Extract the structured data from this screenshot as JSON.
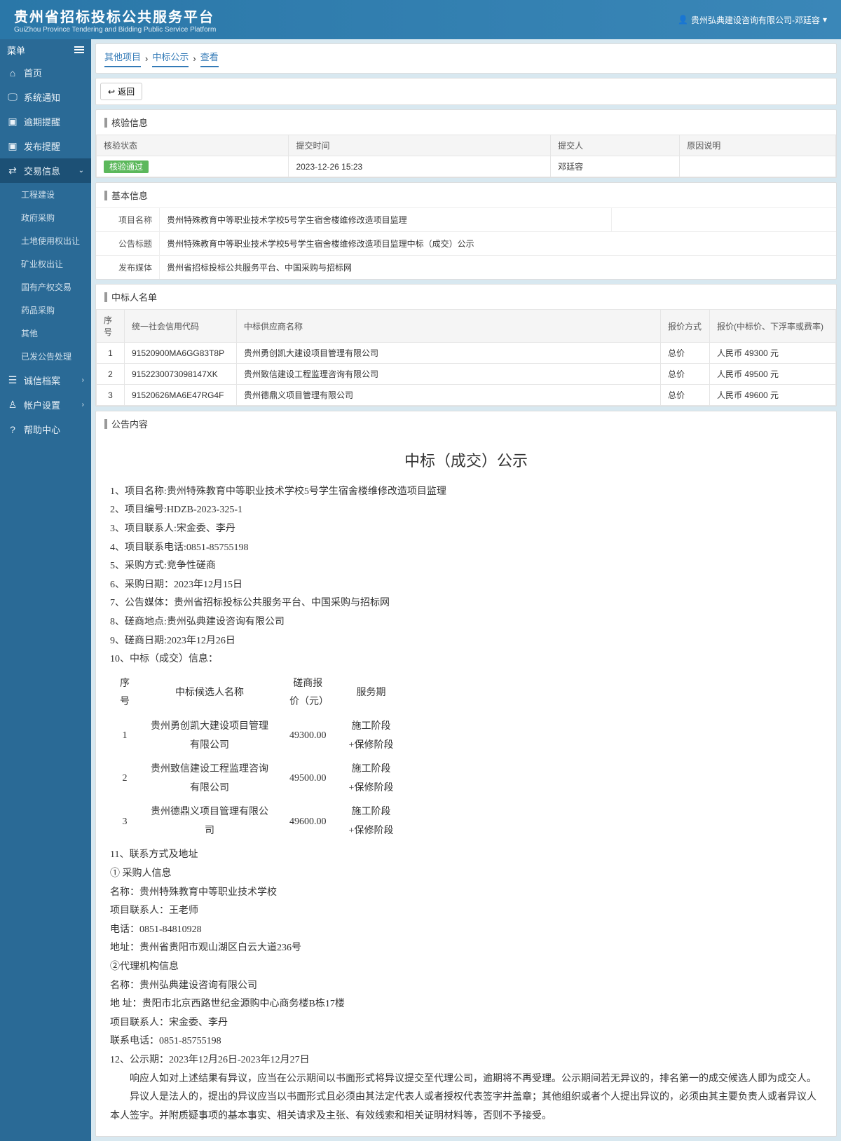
{
  "header": {
    "title": "贵州省招标投标公共服务平台",
    "subtitle": "GuiZhou Province Tendering and Bidding Public Service Platform",
    "user": "贵州弘典建设咨询有限公司-邓廷容"
  },
  "sidebar": {
    "menuLabel": "菜单",
    "items": [
      {
        "icon": "home",
        "label": "首页"
      },
      {
        "icon": "monitor",
        "label": "系统通知"
      },
      {
        "icon": "clock",
        "label": "逾期提醒"
      },
      {
        "icon": "bell",
        "label": "发布提醒"
      },
      {
        "icon": "exchange",
        "label": "交易信息",
        "active": true,
        "expanded": true
      },
      {
        "icon": "file",
        "label": "诚信档案",
        "chev": true
      },
      {
        "icon": "user",
        "label": "帐户设置",
        "chev": true
      },
      {
        "icon": "help",
        "label": "帮助中心"
      }
    ],
    "subItems": [
      "工程建设",
      "政府采购",
      "土地使用权出让",
      "矿业权出让",
      "国有产权交易",
      "药品采购",
      "其他",
      "已发公告处理"
    ]
  },
  "breadcrumb": [
    "其他项目",
    "中标公示",
    "查看"
  ],
  "backLabel": "返回",
  "verify": {
    "title": "核验信息",
    "headers": [
      "核验状态",
      "提交时间",
      "提交人",
      "原因说明"
    ],
    "row": {
      "status": "核验通过",
      "time": "2023-12-26 15:23",
      "submitter": "邓廷容",
      "reason": ""
    }
  },
  "basic": {
    "title": "基本信息",
    "rows": [
      {
        "label": "项目名称",
        "value": "贵州特殊教育中等职业技术学校5号学生宿舍楼维修改造项目监理"
      },
      {
        "label": "公告标题",
        "value": "贵州特殊教育中等职业技术学校5号学生宿舍楼维修改造项目监理中标（成交）公示"
      },
      {
        "label": "发布媒体",
        "value": "贵州省招标投标公共服务平台、中国采购与招标网"
      }
    ]
  },
  "winners": {
    "title": "中标人名单",
    "headers": [
      "序号",
      "统一社会信用代码",
      "中标供应商名称",
      "报价方式",
      "报价(中标价、下浮率或费率)"
    ],
    "rows": [
      {
        "no": "1",
        "code": "91520900MA6GG83T8P",
        "name": "贵州勇创凯大建设项目管理有限公司",
        "method": "总价",
        "price": "人民币 49300 元"
      },
      {
        "no": "2",
        "code": "9152230073098147XK",
        "name": "贵州致信建设工程监理咨询有限公司",
        "method": "总价",
        "price": "人民币 49500 元"
      },
      {
        "no": "3",
        "code": "91520626MA6E47RG4F",
        "name": "贵州德鼎义项目管理有限公司",
        "method": "总价",
        "price": "人民币 49600 元"
      }
    ]
  },
  "notice": {
    "title": "公告内容",
    "heading": "中标（成交）公示",
    "lines1": [
      "1、项目名称:贵州特殊教育中等职业技术学校5号学生宿舍楼维修改造项目监理",
      "2、项目编号:HDZB-2023-325-1",
      "3、项目联系人:宋金委、李丹",
      "4、项目联系电话:0851-85755198",
      "5、采购方式:竞争性磋商",
      "6、采购日期：2023年12月15日",
      "7、公告媒体：贵州省招标投标公共服务平台、中国采购与招标网",
      "8、磋商地点:贵州弘典建设咨询有限公司",
      "9、磋商日期:2023年12月26日",
      "10、中标（成交）信息："
    ],
    "tableHeaders": [
      "序号",
      "中标候选人名称",
      "磋商报价（元）",
      "服务期"
    ],
    "tableRows": [
      {
        "no": "1",
        "name": "贵州勇创凯大建设项目管理有限公司",
        "price": "49300.00",
        "period": "施工阶段+保修阶段"
      },
      {
        "no": "2",
        "name": "贵州致信建设工程监理咨询有限公司",
        "price": "49500.00",
        "period": "施工阶段+保修阶段"
      },
      {
        "no": "3",
        "name": "贵州德鼎义项目管理有限公司",
        "price": "49600.00",
        "period": "施工阶段+保修阶段"
      }
    ],
    "lines2": [
      "11、联系方式及地址",
      "① 采购人信息",
      "名称：贵州特殊教育中等职业技术学校",
      "项目联系人：王老师",
      "电话：0851-84810928",
      "地址：贵州省贵阳市观山湖区白云大道236号",
      "②代理机构信息",
      "名称：贵州弘典建设咨询有限公司",
      "地    址：贵阳市北京西路世纪金源购中心商务楼B栋17楼",
      "项目联系人：宋金委、李丹",
      "联系电话：0851-85755198",
      "12、公示期：2023年12月26日-2023年12月27日"
    ],
    "para1": "响应人如对上述结果有异议，应当在公示期间以书面形式将异议提交至代理公司，逾期将不再受理。公示期间若无异议的，排名第一的成交候选人即为成交人。",
    "para2": "异议人是法人的，提出的异议应当以书面形式且必须由其法定代表人或者授权代表签字并盖章；其他组织或者个人提出异议的，必须由其主要负责人或者异议人本人签字。并附质疑事项的基本事实、相关请求及主张、有效线索和相关证明材料等，否则不予接受。"
  }
}
